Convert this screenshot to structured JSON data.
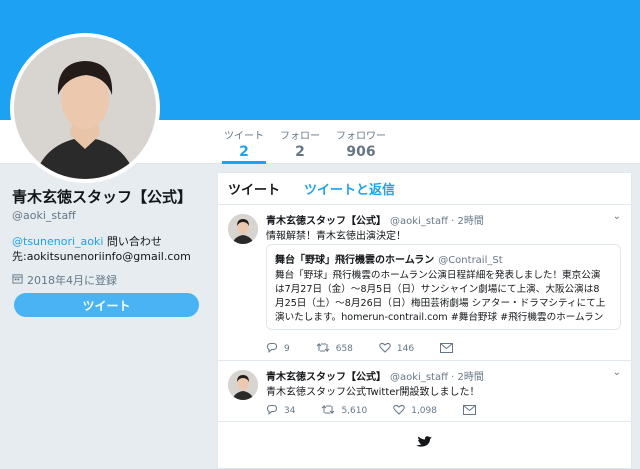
{
  "colors": {
    "brand": "#1da1f2",
    "text": "#14171a",
    "secondary": "#657786"
  },
  "stats": [
    {
      "label": "ツイート",
      "value": "2"
    },
    {
      "label": "フォロー",
      "value": "2"
    },
    {
      "label": "フォロワー",
      "value": "906"
    }
  ],
  "profile": {
    "name": "青木玄徳スタッフ【公式】",
    "handle": "@aoki_staff",
    "bio_link": "@tsunenori_aoki",
    "bio_text": " 問い合わせ",
    "bio_line2": "先:aokitsunenoriinfo@gmail.com",
    "joined": "2018年4月に登録",
    "tweet_button": "ツイート"
  },
  "timeline": {
    "tabs": [
      "ツイート",
      "ツイートと返信"
    ],
    "tweets": [
      {
        "name": "青木玄徳スタッフ【公式】",
        "handle": "@aoki_staff · 2時間",
        "text": "情報解禁！青木玄徳出演決定！",
        "quote": {
          "title": "舞台「野球」飛行機雲のホームラン",
          "handle": "@Contrail_St",
          "lines": [
            "舞台「野球」飛行機雲のホームラン公演日程詳細を発表しました！東京公演",
            "は7月27日（金）〜8月5日（日）サンシャイン劇場にて上演、大阪公演は8",
            "月25日（土）〜8月26日（日）梅田芸術劇場 シアター・ドラマシティにて上",
            "演いたします。homerun-contrail.com #舞台野球 #飛行機雲のホームラン"
          ]
        },
        "replies": "9",
        "retweets": "658",
        "likes": "146"
      },
      {
        "name": "青木玄徳スタッフ【公式】",
        "handle": "@aoki_staff · 2時間",
        "text": "青木玄徳スタッフ公式Twitter開設致しました！",
        "replies": "34",
        "retweets": "5,610",
        "likes": "1,098"
      }
    ]
  },
  "icons": [
    "calendar-icon",
    "chevron-down-icon",
    "reply-icon",
    "retweet-icon",
    "like-icon",
    "mail-icon",
    "twitter-bird-icon"
  ]
}
